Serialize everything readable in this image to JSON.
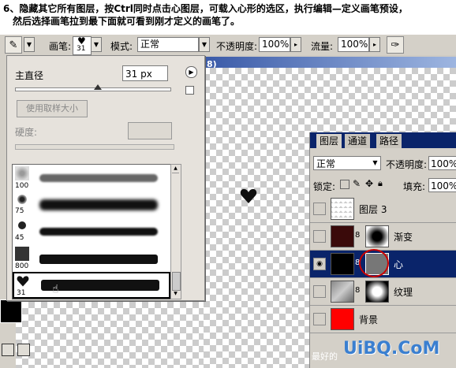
{
  "instruction": {
    "line1": "6、隐藏其它所有图层，按Ctrl同时点击心图层，可载入心形的选区，执行编辑—定义画笔预设，",
    "line2": "然后选择画笔拉到最下面就可看到刚才定义的画笔了。"
  },
  "options_bar": {
    "brush_label": "画笔:",
    "brush_size": "31",
    "mode_label": "模式:",
    "mode_value": "正常",
    "opacity_label": "不透明度:",
    "opacity_value": "100%",
    "flow_label": "流量:",
    "flow_value": "100%"
  },
  "document": {
    "title_fragment": "8)"
  },
  "brush_popup": {
    "diameter_label": "主直径",
    "diameter_value": "31 px",
    "use_sample_label": "使用取样大小",
    "hardness_label": "硬度:",
    "brushes": [
      {
        "size": "100"
      },
      {
        "size": "75"
      },
      {
        "size": "45"
      },
      {
        "size": "800"
      },
      {
        "size": "31"
      }
    ]
  },
  "layers_panel": {
    "tabs": [
      "图层",
      "通道",
      "路径"
    ],
    "blend_mode": "正常",
    "opacity_label": "不透明度:",
    "opacity_value": "100%",
    "lock_label": "锁定:",
    "fill_label": "填充:",
    "fill_value": "100%",
    "layers": [
      {
        "name": "图层 3",
        "visible": false,
        "selected": false
      },
      {
        "name": "渐变",
        "visible": false,
        "selected": false
      },
      {
        "name": "心",
        "visible": true,
        "selected": true
      },
      {
        "name": "纹理",
        "visible": false,
        "selected": false
      },
      {
        "name": "背景",
        "visible": false,
        "selected": false
      }
    ]
  },
  "watermark": {
    "text": "UiBQ.CoM",
    "subtext": "最好的"
  },
  "colors": {
    "selection_blue": "#0a246a",
    "background_layer_red": "#ff0000",
    "gradient_layer_dark": "#3a0a0a"
  },
  "icons": [
    "brush-icon",
    "airbrush-icon",
    "eye-icon",
    "link-icon",
    "lock-icon",
    "menu-arrow-icon",
    "cursor-hand-icon",
    "heart-icon"
  ]
}
